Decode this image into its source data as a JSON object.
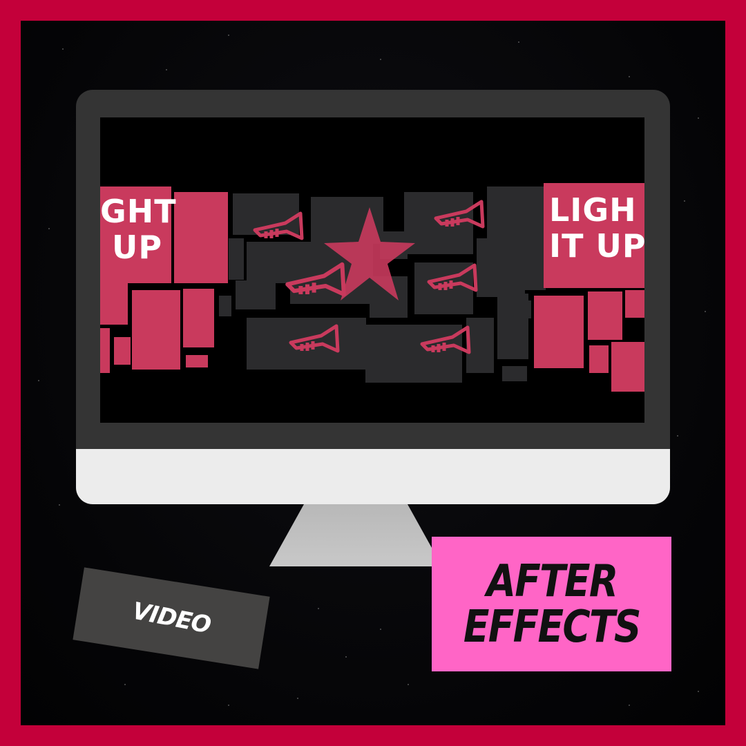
{
  "screen": {
    "left_text": "GHT\n UP",
    "right_text": "LIGH\nIT UP"
  },
  "tags": {
    "video": "VIDEO",
    "product_line1": "AFTER",
    "product_line2": "EFFECTS"
  },
  "colors": {
    "border": "#c4003a",
    "tile_pink": "#c93a5d",
    "tile_dark": "#2b2b2d",
    "ae_box": "#ff65c6",
    "video_tag": "#444342"
  },
  "icons": [
    "trumpet-icon"
  ]
}
